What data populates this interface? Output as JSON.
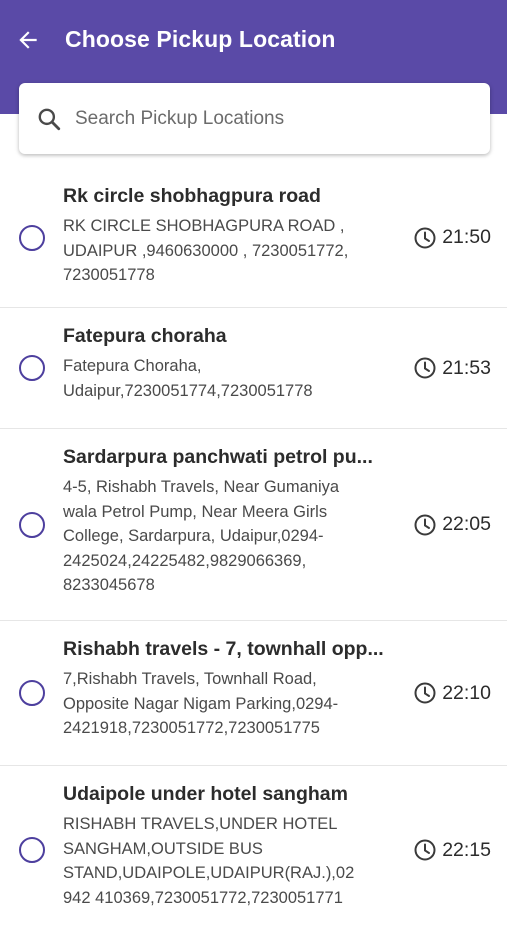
{
  "header": {
    "title": "Choose Pickup Location",
    "back_icon": "arrow-left-icon",
    "background": "#5a4aa7"
  },
  "search": {
    "placeholder": "Search Pickup Locations",
    "value": "",
    "icon": "search-icon"
  },
  "locations": [
    {
      "name": "Rk circle shobhagpura road",
      "address": "RK CIRCLE SHOBHAGPURA ROAD , UDAIPUR ,9460630000 , 7230051772, 7230051778",
      "time": "21:50",
      "selected": false
    },
    {
      "name": "Fatepura choraha",
      "address": "Fatepura Choraha, Udaipur,7230051774,7230051778",
      "time": "21:53",
      "selected": false
    },
    {
      "name": "Sardarpura panchwati petrol pu...",
      "address": "4-5, Rishabh Travels, Near Gumaniya wala Petrol Pump, Near Meera Girls College, Sardarpura, Udaipur,0294-2425024,24225482,9829066369, 8233045678",
      "time": "22:05",
      "selected": false
    },
    {
      "name": "Rishabh travels - 7, townhall opp...",
      "address": "7,Rishabh Travels, Townhall Road, Opposite Nagar Nigam Parking,0294-2421918,7230051772,7230051775",
      "time": "22:10",
      "selected": false
    },
    {
      "name": "Udaipole under hotel sangham",
      "address": "RISHABH TRAVELS,UNDER HOTEL SANGHAM,OUTSIDE BUS STAND,UDAIPOLE,UDAIPUR(RAJ.),02942 410369,7230051772,7230051771",
      "time": "22:15",
      "selected": false
    }
  ]
}
